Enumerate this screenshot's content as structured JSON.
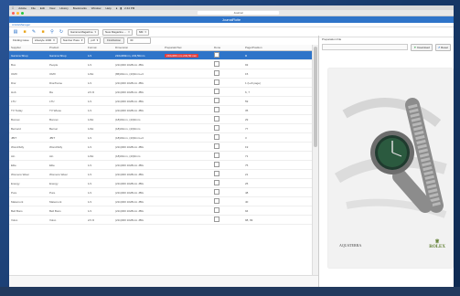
{
  "menubar": {
    "items": [
      "Adobe",
      "File",
      "Edit",
      "View",
      "History",
      "Bookmarks",
      "Window",
      "Help"
    ],
    "right": [
      "2:44 PM"
    ]
  },
  "window": {
    "url": "Journal"
  },
  "app": {
    "title": "JournalFlotte",
    "subtitle": "ArticleManager"
  },
  "toolbar": {
    "selects": [
      "Gamma Magazine",
      "New Magazine ...",
      "NM"
    ]
  },
  "filters": {
    "label1": "Finding issue",
    "select1": "Lifestyle 1000",
    "select2": "Number Pass",
    "select3": "pdf",
    "button": "Find/Action",
    "value": "30"
  },
  "table": {
    "columns": [
      "Supplier",
      "Product",
      "Format",
      "Dimension",
      "Preparatn/Set",
      "Done",
      "Page/Position"
    ],
    "rows": [
      [
        "Gamma Shop",
        "Gamma Shop",
        "1/1",
        "210x280mm, 243,50mm",
        "210x280 mm 243,50 mm",
        "",
        "R"
      ],
      [
        "Box",
        "People",
        "1/1",
        "(211)000 1028mm JBG",
        "",
        "",
        "93"
      ],
      [
        "OMX",
        "OMX",
        "1/2H",
        "(86)00mm, (43)0mm+3",
        "",
        "",
        "15"
      ],
      [
        "Dior",
        "Dior/Fame",
        "1/1",
        "(211)000 1028mm JBG",
        "",
        "",
        "1 (Left page)"
      ],
      [
        "Hub",
        "Ra",
        "2/1 D",
        "(211)000 1028mm JBG",
        "",
        "",
        "6, 7"
      ],
      [
        "LTU",
        "LTU",
        "1/1",
        "(211)000 1028mm JBG",
        "",
        "",
        "59"
      ],
      [
        "TV Today",
        "TV Wiese",
        "1/1",
        "(211)000 1028mm JBG",
        "",
        "",
        "35"
      ],
      [
        "Bonnet",
        "Bonnet",
        "1/2H",
        "(18)00mm, (43)0mm",
        "",
        "",
        "29"
      ],
      [
        "Bernard",
        "Bernar",
        "1/2H",
        "(18)00mm, (43)0mm",
        "",
        "",
        "77"
      ],
      [
        "JBIT",
        "JBIT",
        "1/1",
        "(18)00mm, (43)0mm+3",
        "",
        "",
        "3"
      ],
      [
        "Wondrfully",
        "Wondrfully",
        "1/1",
        "(211)000 1028mm JBG",
        "",
        "",
        "19"
      ],
      [
        "Ain",
        "Ain",
        "1/2H",
        "(18)00mm, (43)0mm",
        "",
        "",
        "71"
      ],
      [
        "Elite",
        "Elite",
        "1/1",
        "(211)000 1028mm JBG",
        "",
        "",
        "75"
      ],
      [
        "Womens Wear",
        "Womens Wear",
        "1/1",
        "(211)000 1028mm JBG",
        "",
        "",
        "21"
      ],
      [
        "Energy",
        "Energy",
        "1/1",
        "(211)000 1028mm JBG",
        "",
        "",
        "25"
      ],
      [
        "Pure",
        "Pure",
        "1/1",
        "(211)000 1028mm JBG",
        "",
        "",
        "48"
      ],
      [
        "Matemont",
        "Matemont",
        "1/1",
        "(211)000 1028mm JBG",
        "",
        "",
        "40"
      ],
      [
        "Bell Bons",
        "Bell Bons",
        "1/1",
        "(211)000 1028mm JBG",
        "",
        "",
        "94"
      ],
      [
        "Volvo",
        "Volvo",
        "2/1 D",
        "(211)000 1028mm JBG",
        "",
        "",
        "98, 99"
      ]
    ]
  },
  "preview": {
    "label": "Preparation File",
    "download": "Download",
    "reset": "Reset",
    "brand_text": "AQUATERRA",
    "logo_text": "ROLEX"
  },
  "colors": {
    "accent": "#2e74c9",
    "highlight": "#e23d3d"
  }
}
